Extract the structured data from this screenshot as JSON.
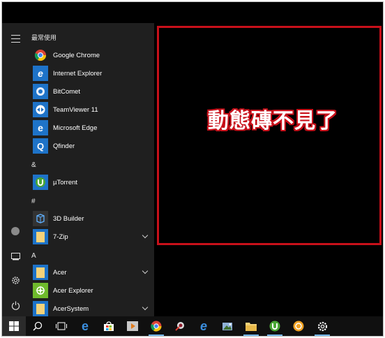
{
  "start_menu": {
    "section_most_used": "最常使用",
    "most_used": [
      {
        "label": "Google Chrome",
        "icon": "chrome-icon"
      },
      {
        "label": "Internet Explorer",
        "icon": "internet-explorer-icon"
      },
      {
        "label": "BitComet",
        "icon": "bitcomet-icon"
      },
      {
        "label": "TeamViewer 11",
        "icon": "teamviewer-icon"
      },
      {
        "label": "Microsoft Edge",
        "icon": "edge-icon"
      },
      {
        "label": "Qfinder",
        "icon": "qfinder-icon"
      }
    ],
    "section_amp": "&",
    "amp_items": [
      {
        "label": "µTorrent",
        "icon": "utorrent-icon"
      }
    ],
    "section_hash": "#",
    "hash_items": [
      {
        "label": "3D Builder",
        "icon": "3d-builder-icon"
      },
      {
        "label": "7-Zip",
        "icon": "folder-icon",
        "expandable": true
      }
    ],
    "section_a": "A",
    "a_items": [
      {
        "label": "Acer",
        "icon": "folder-icon",
        "expandable": true
      },
      {
        "label": "Acer Explorer",
        "icon": "acer-explorer-icon"
      },
      {
        "label": "AcerSystem",
        "icon": "folder-icon",
        "expandable": true
      }
    ]
  },
  "annotation_text": "動態磚不見了",
  "colors": {
    "annotation_border": "#c8101a",
    "menu_bg": "#1f1f1f",
    "taskbar_bg": "#101010",
    "accent_blue": "#1e73c8"
  },
  "taskbar": [
    "windows-start-icon",
    "search-icon",
    "task-view-icon",
    "edge-icon",
    "store-icon",
    "media-player-icon",
    "chrome-icon",
    "bitcomet-icon",
    "internet-explorer-icon",
    "image-viewer-icon",
    "file-explorer-icon",
    "utorrent-icon",
    "qfinder-icon",
    "settings-gear-icon"
  ]
}
